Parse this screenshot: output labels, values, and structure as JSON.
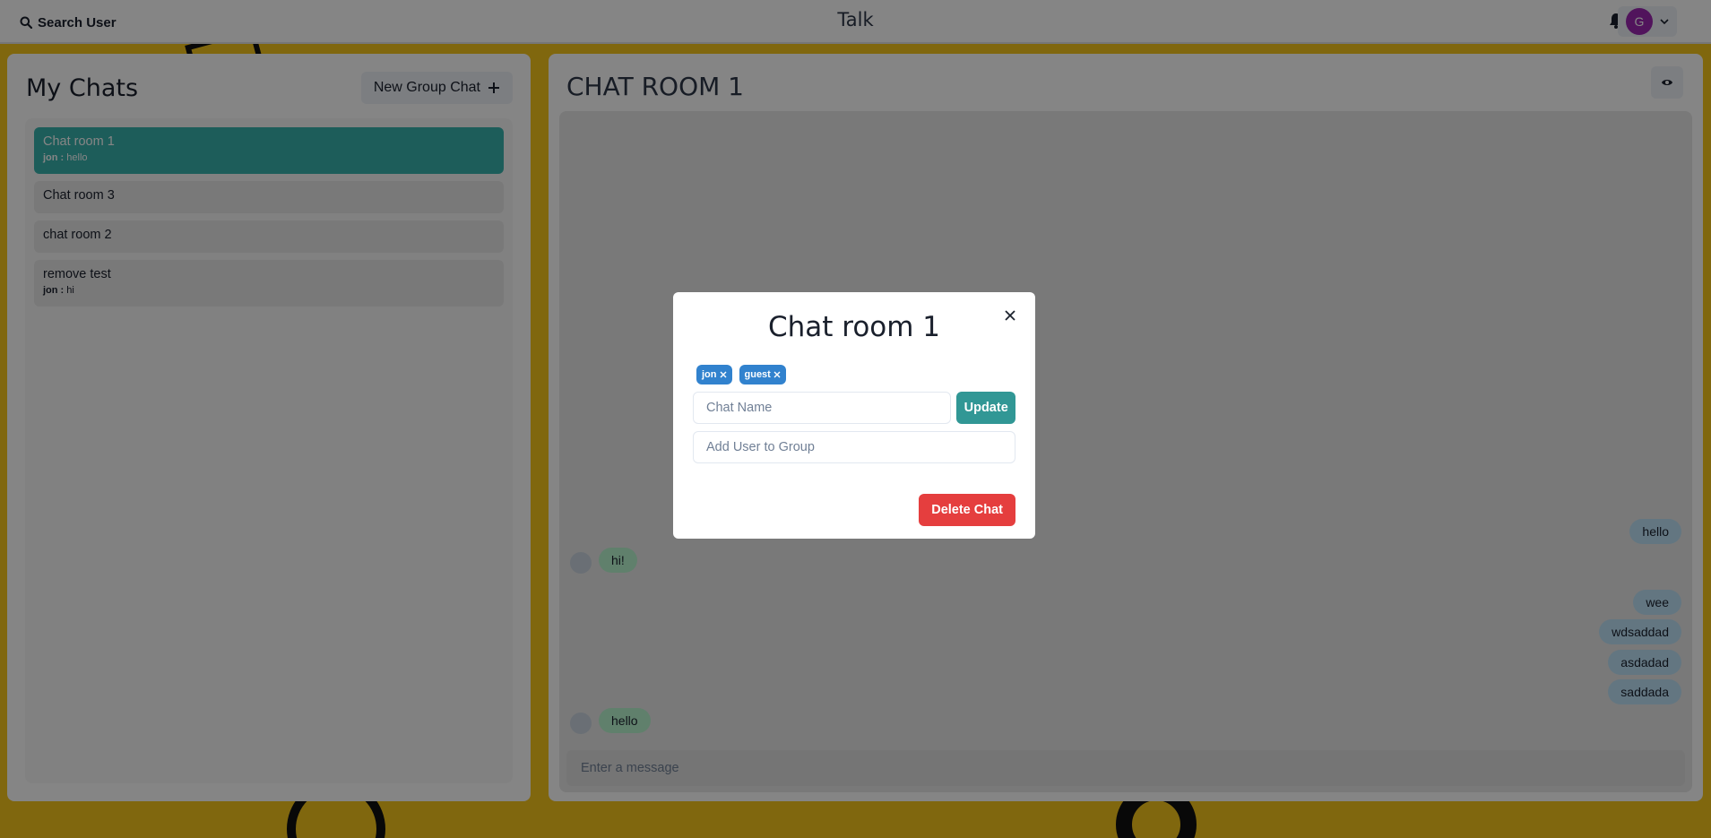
{
  "topbar": {
    "search_label": "Search User",
    "app_title": "Talk",
    "avatar_initial": "G",
    "avatar_color": "#9C27B0"
  },
  "sidebar": {
    "title": "My Chats",
    "new_group_label": "New Group Chat",
    "chats": [
      {
        "name": "Chat room 1",
        "latest_sender": "jon :",
        "latest_text": "hello",
        "active": true
      },
      {
        "name": "Chat room 3"
      },
      {
        "name": "chat room 2"
      },
      {
        "name": "remove test",
        "latest_sender": "jon :",
        "latest_text": "hi"
      }
    ]
  },
  "chat": {
    "room_title": "CHAT ROOM 1",
    "messages": [
      {
        "text": "hello",
        "mine": true
      },
      {
        "text": "hi!",
        "mine": false
      },
      {
        "text": "wee",
        "mine": true
      },
      {
        "text": "wdsaddad",
        "mine": true
      },
      {
        "text": "asdadad",
        "mine": true
      },
      {
        "text": "saddada",
        "mine": true
      },
      {
        "text": "hello",
        "mine": false
      }
    ],
    "input_placeholder": "Enter a message"
  },
  "modal": {
    "title": "Chat room 1",
    "members": [
      "jon",
      "guest"
    ],
    "chat_name_placeholder": "Chat Name",
    "update_label": "Update",
    "add_user_placeholder": "Add User to Group",
    "delete_label": "Delete Chat"
  },
  "colors": {
    "background": "#F6C51C",
    "active_chat": "#38B2AC",
    "badge": "#3182CE",
    "update_button": "#319795",
    "delete_button": "#E53E3E",
    "my_bubble": "#BEE3F8",
    "their_bubble": "#B9F5D0"
  }
}
